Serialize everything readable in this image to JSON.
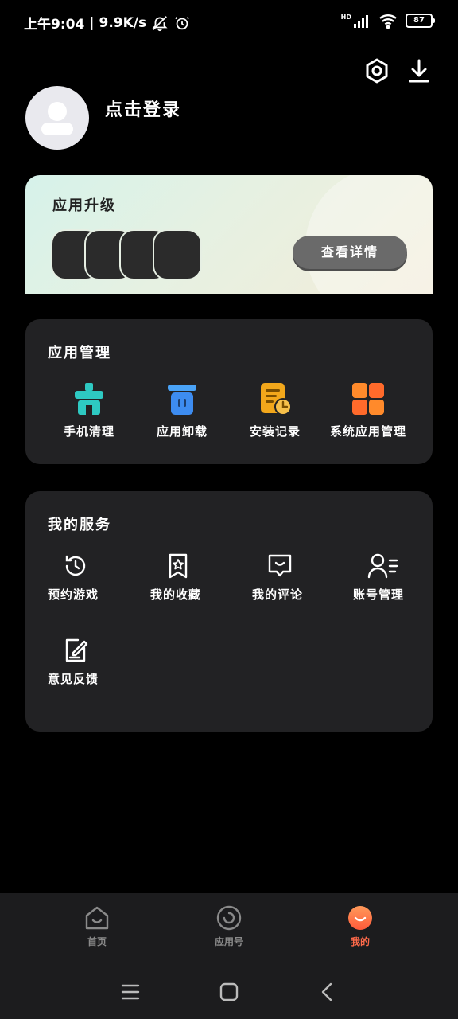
{
  "status": {
    "time": "上午9:04",
    "speed": "9.9K/s",
    "battery": "87",
    "network": "HD"
  },
  "header": {
    "login_text": "点击登录"
  },
  "upgrade": {
    "title": "应用升级",
    "detail_button": "查看详情"
  },
  "app_management": {
    "title": "应用管理",
    "items": [
      {
        "label": "手机清理",
        "icon": "phone-clean-icon",
        "color": "#2ec9c2"
      },
      {
        "label": "应用卸载",
        "icon": "uninstall-icon",
        "color": "#3d8cf0"
      },
      {
        "label": "安装记录",
        "icon": "install-record-icon",
        "color": "#f2a71b"
      },
      {
        "label": "系统应用管理",
        "icon": "system-apps-icon",
        "color": "#ff6a2b"
      }
    ]
  },
  "services": {
    "title": "我的服务",
    "items": [
      {
        "label": "预约游戏",
        "icon": "history-icon"
      },
      {
        "label": "我的收藏",
        "icon": "bookmark-star-icon"
      },
      {
        "label": "我的评论",
        "icon": "comment-icon"
      },
      {
        "label": "账号管理",
        "icon": "account-icon"
      },
      {
        "label": "意见反馈",
        "icon": "feedback-icon"
      }
    ]
  },
  "nav": {
    "items": [
      {
        "label": "首页",
        "icon": "home-icon"
      },
      {
        "label": "应用号",
        "icon": "app-account-icon"
      },
      {
        "label": "我的",
        "icon": "me-icon",
        "active": true
      }
    ],
    "accent": "#ff6a4a"
  }
}
